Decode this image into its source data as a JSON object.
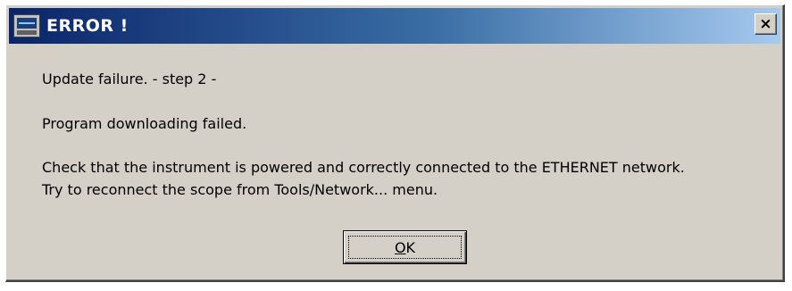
{
  "window": {
    "title": "ERROR !",
    "app_icon": "instrument-app-icon",
    "close_symbol": "×",
    "close_icon": "close-icon"
  },
  "message": {
    "line1": "Update failure. - step 2 -",
    "line2": "Program downloading failed.",
    "line3": "Check that the instrument is powered and correctly connected to the ETHERNET network.",
    "line4": "Try to reconnect the scope from Tools/Network... menu."
  },
  "buttons": {
    "ok_mnemonic": "O",
    "ok_rest": "K"
  },
  "colors": {
    "titlebar_start": "#0a246a",
    "titlebar_end": "#a6caf0",
    "face": "#d4d0c8"
  }
}
